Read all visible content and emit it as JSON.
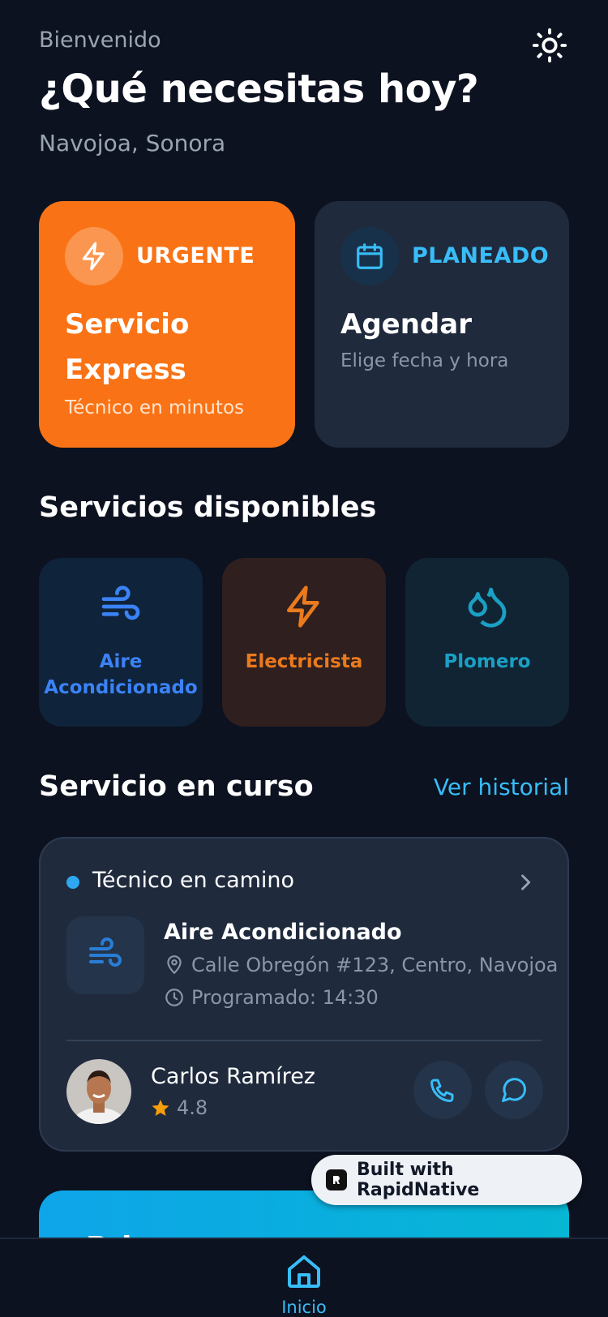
{
  "header": {
    "greeting": "Bienvenido",
    "headline": "¿Qué necesitas hoy?",
    "location": "Navojoa, Sonora",
    "theme_icon": "sun-icon"
  },
  "quick_actions": {
    "urgent": {
      "badge": "URGENTE",
      "title": "Servicio Express",
      "subtitle": "Técnico en minutos",
      "icon": "bolt-icon",
      "color": "#f97316"
    },
    "planned": {
      "badge": "PLANEADO",
      "title": "Agendar",
      "subtitle": "Elige fecha y hora",
      "icon": "calendar-icon",
      "color": "#38bdf8"
    }
  },
  "services": {
    "title": "Servicios disponibles",
    "items": [
      {
        "label": "Aire Acondicionado",
        "icon": "wind-icon",
        "color": "#3b82f6"
      },
      {
        "label": "Electricista",
        "icon": "bolt-icon",
        "color": "#ea7a1e"
      },
      {
        "label": "Plomero",
        "icon": "droplets-icon",
        "color": "#1aa0c4"
      }
    ]
  },
  "current_service": {
    "title": "Servicio en curso",
    "history_link": "Ver historial",
    "status": "Técnico en camino",
    "service_name": "Aire Acondicionado",
    "address": "Calle Obregón #123, Centro, Navojoa",
    "scheduled": "Programado: 14:30",
    "technician": {
      "name": "Carlos Ramírez",
      "rating": "4.8"
    }
  },
  "promo": {
    "text": "Primer…"
  },
  "badge": {
    "text": "Built with RapidNative"
  },
  "nav": {
    "home_label": "Inicio"
  }
}
